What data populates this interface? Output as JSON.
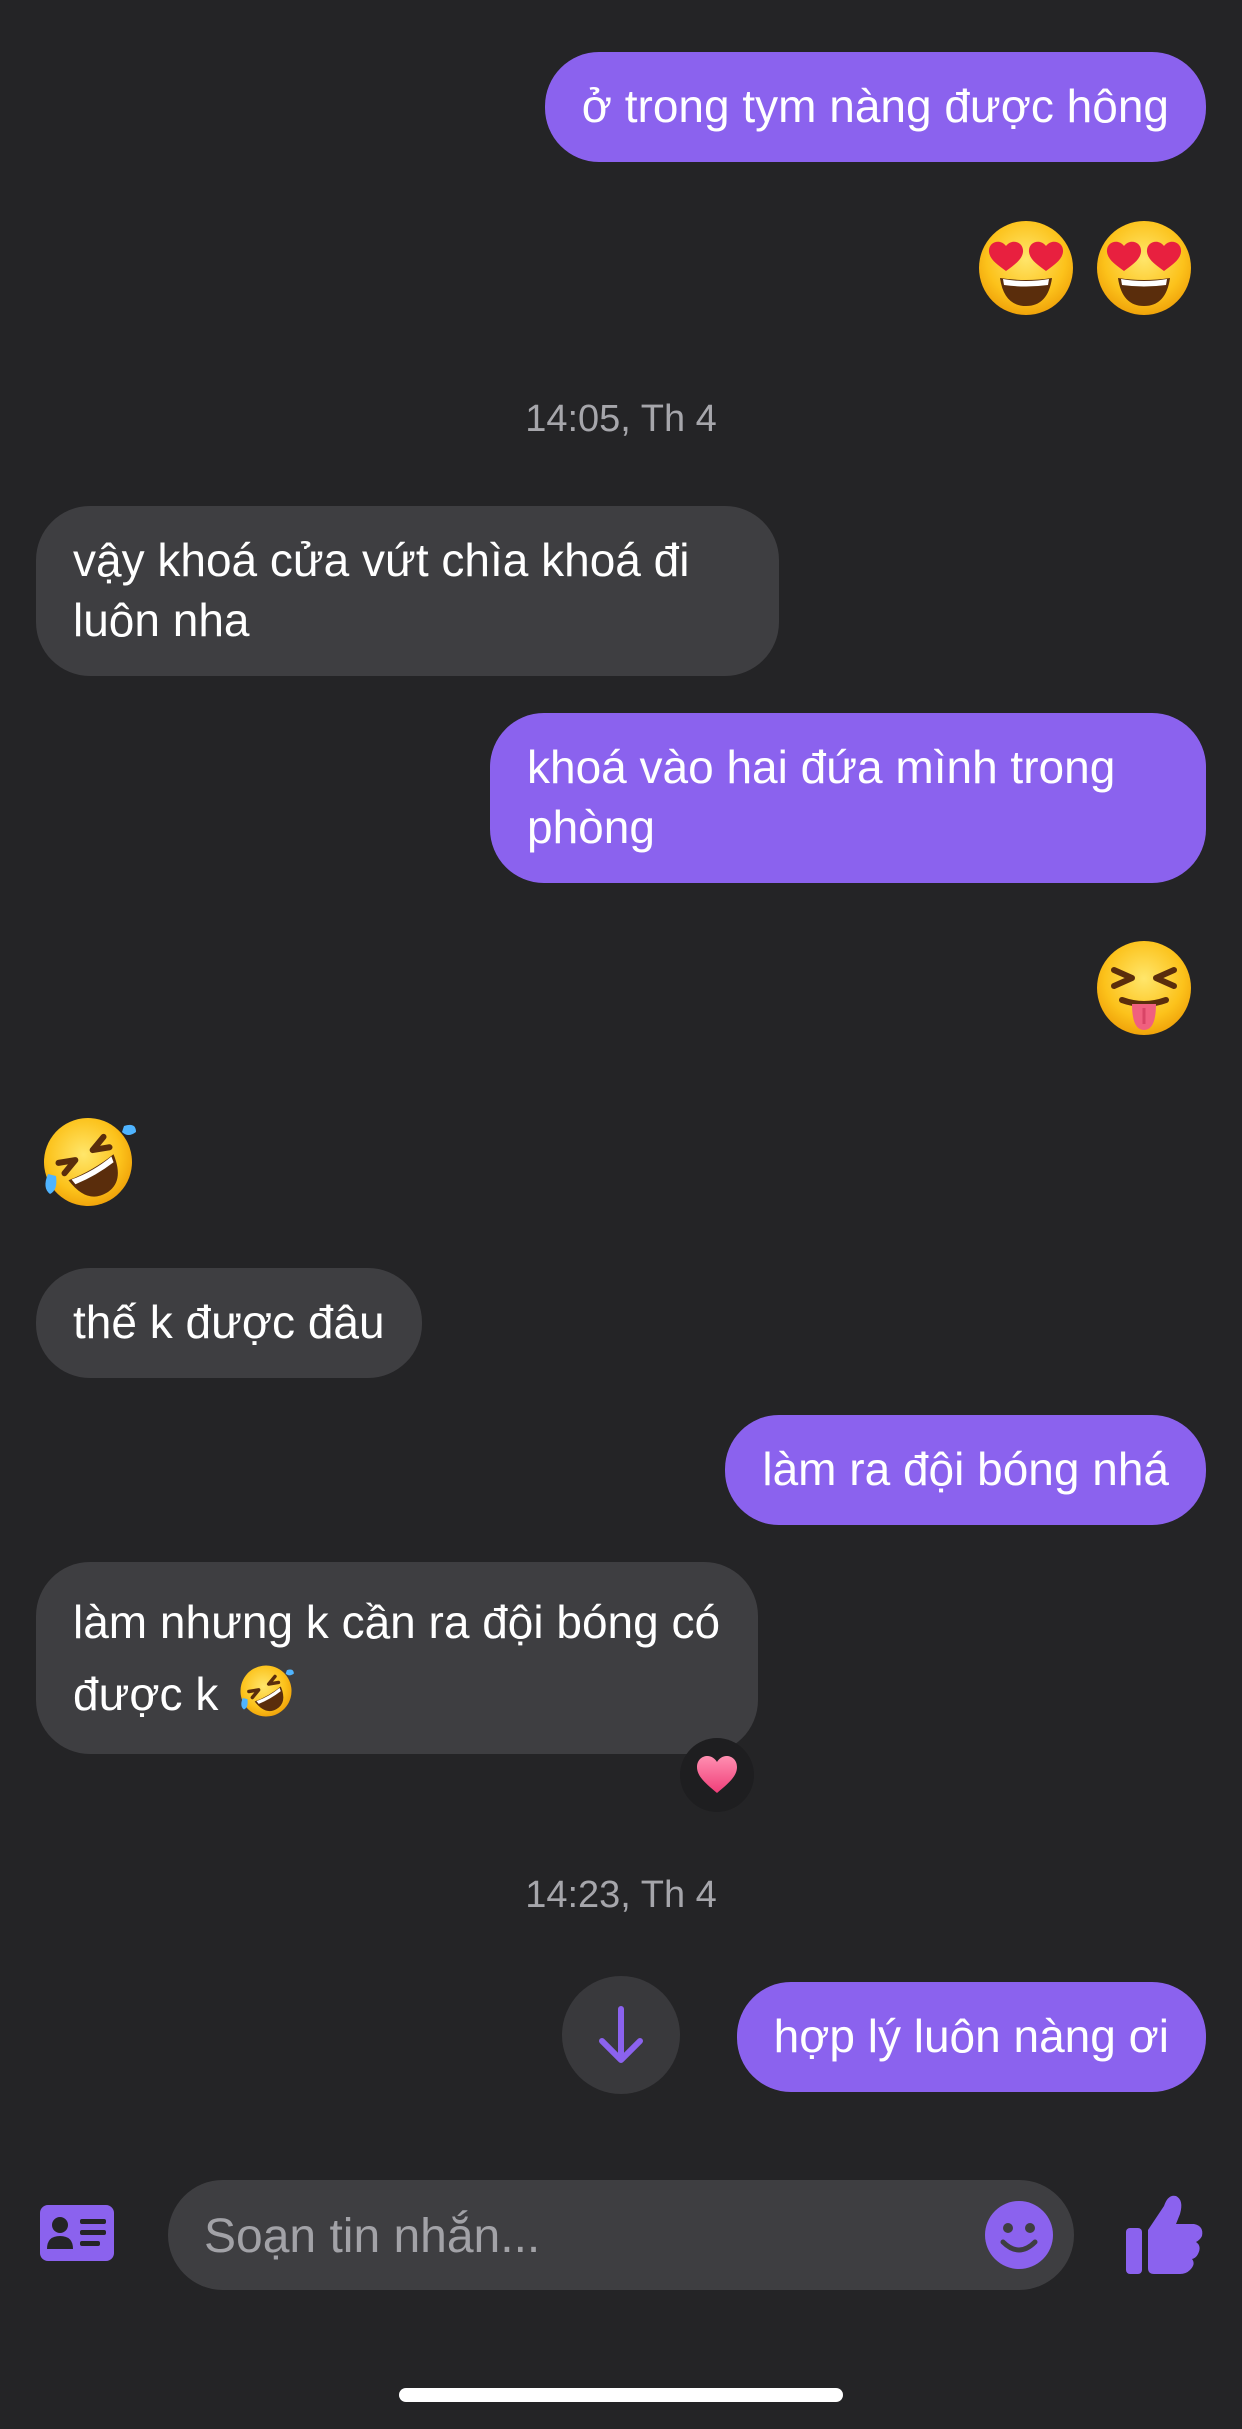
{
  "messages": {
    "m1": "ở trong tym nàng được hông",
    "m2": "vậy khoá cửa vứt chìa khoá đi luôn nha",
    "m3": "khoá vào hai đứa mình trong phòng",
    "m4": "thế k được đâu",
    "m5": "làm ra đội bóng nhá",
    "m6": "làm nhưng k cần ra đội bóng có được k",
    "m7": "hợp lý luôn nàng ơi"
  },
  "timestamps": {
    "t1": "14:05, Th 4",
    "t2": "14:23, Th 4"
  },
  "emoji": {
    "heart_eyes": "smiling-face-with-heart-eyes",
    "tongue": "squinting-face-with-tongue",
    "rofl": "rolling-on-the-floor-laughing",
    "reaction": "heart"
  },
  "composer": {
    "placeholder": "Soạn tin nhắn..."
  },
  "colors": {
    "background": "#242426",
    "outgoing_bubble": "#8b62ee",
    "incoming_bubble": "#3e3e41",
    "accent": "#8b62ee"
  }
}
